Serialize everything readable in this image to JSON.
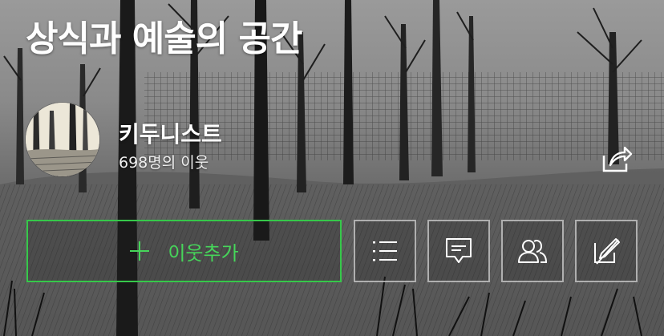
{
  "blog": {
    "title": "상식과 예술의 공간",
    "nickname": "키두니스트",
    "neighbors_count": "698명의 이웃"
  },
  "actions": {
    "add_neighbor_label": "이웃추가",
    "add_neighbor_icon": "plus-icon",
    "share_icon": "share-icon",
    "buttons": [
      {
        "icon": "list-icon"
      },
      {
        "icon": "comment-icon"
      },
      {
        "icon": "neighbors-icon"
      },
      {
        "icon": "write-icon"
      }
    ]
  },
  "colors": {
    "accent": "#36c84a",
    "text": "#ffffff",
    "border": "#d2d2d2"
  }
}
